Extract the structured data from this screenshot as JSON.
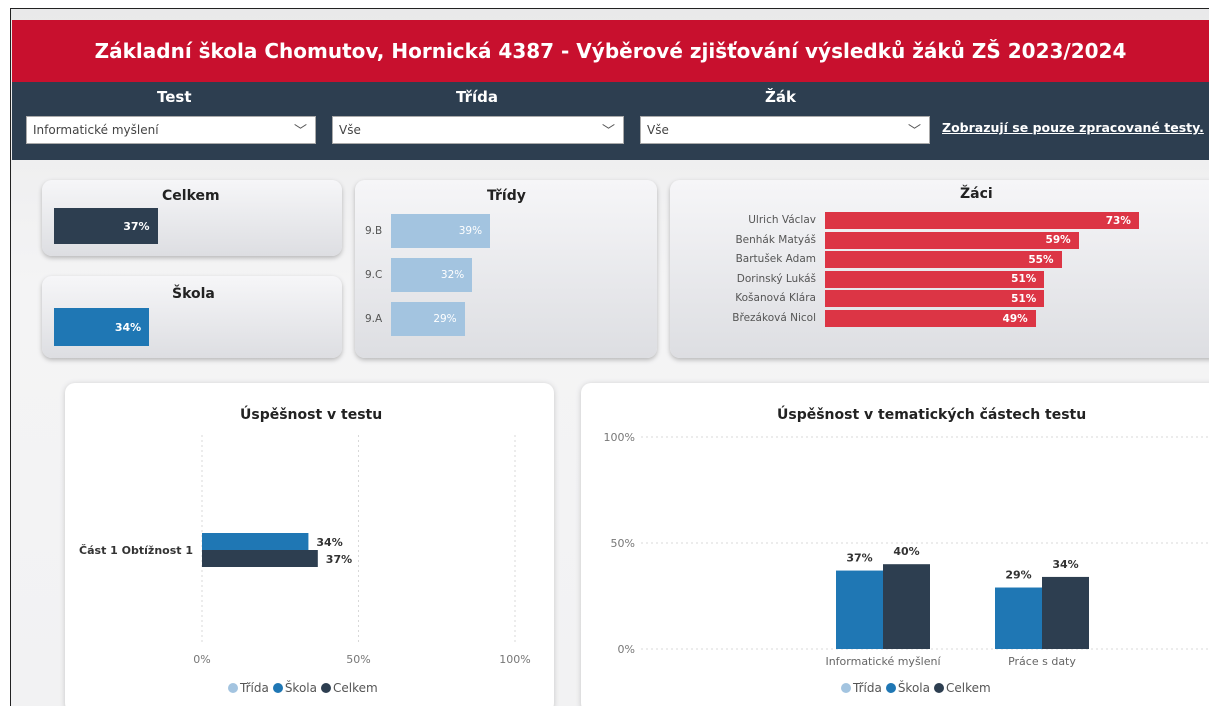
{
  "header": {
    "title": "Základní škola Chomutov, Hornická 4387 - Výběrové zjišťování výsledků žáků ZŠ 2023/2024"
  },
  "filters": {
    "test": {
      "label": "Test",
      "value": "Informatické myšlení"
    },
    "trida": {
      "label": "Třída",
      "value": "Vše"
    },
    "zak": {
      "label": "Žák",
      "value": "Vše"
    },
    "note": "Zobrazují se pouze zpracované testy."
  },
  "kpi": {
    "celkem": {
      "title": "Celkem",
      "value": "37%",
      "fraction": 0.37
    },
    "skola": {
      "title": "Škola",
      "value": "34%",
      "fraction": 0.34
    }
  },
  "tridy": {
    "title": "Třídy",
    "rows": [
      {
        "label": "9.B",
        "value": "39%",
        "fraction": 0.39
      },
      {
        "label": "9.C",
        "value": "32%",
        "fraction": 0.32
      },
      {
        "label": "9.A",
        "value": "29%",
        "fraction": 0.29
      }
    ]
  },
  "zaci": {
    "title": "Žáci",
    "rows": [
      {
        "label": "Ulrich Václav",
        "value": "73%",
        "fraction": 0.73
      },
      {
        "label": "Benhák Matyáš",
        "value": "59%",
        "fraction": 0.59
      },
      {
        "label": "Bartušek Adam",
        "value": "55%",
        "fraction": 0.55
      },
      {
        "label": "Dorinský Lukáš",
        "value": "51%",
        "fraction": 0.51
      },
      {
        "label": "Košanová Klára",
        "value": "51%",
        "fraction": 0.51
      },
      {
        "label": "Březáková Nicol",
        "value": "49%",
        "fraction": 0.49
      }
    ]
  },
  "colors": {
    "trida": "#a3c4e0",
    "skola": "#1f77b4",
    "celkem": "#2d3e50",
    "zaci": "#dc3545",
    "header": "#c8102e"
  },
  "chart_data": [
    {
      "type": "bar",
      "orientation": "horizontal",
      "title": "Úspěšnost v testu",
      "categories": [
        "Část 1 Obtížnost 1"
      ],
      "series": [
        {
          "name": "Škola",
          "values": [
            34
          ],
          "labels": [
            "34%"
          ]
        },
        {
          "name": "Celkem",
          "values": [
            37
          ],
          "labels": [
            "37%"
          ]
        }
      ],
      "xlim": [
        0,
        100
      ],
      "ticks": [
        "0%",
        "50%",
        "100%"
      ],
      "grid": true,
      "legend": [
        "Třída",
        "Škola",
        "Celkem"
      ],
      "legend_position": "bottom"
    },
    {
      "type": "bar",
      "title": "Úspěšnost v tematických částech testu",
      "categories": [
        "Informatické myšlení",
        "Práce s daty"
      ],
      "series": [
        {
          "name": "Škola",
          "values": [
            37,
            29
          ],
          "labels": [
            "37%",
            "29%"
          ]
        },
        {
          "name": "Celkem",
          "values": [
            40,
            34
          ],
          "labels": [
            "40%",
            "34%"
          ]
        }
      ],
      "ylim": [
        0,
        100
      ],
      "ticks": [
        "0%",
        "50%",
        "100%"
      ],
      "grid": true,
      "legend": [
        "Třída",
        "Škola",
        "Celkem"
      ],
      "legend_position": "bottom"
    }
  ]
}
